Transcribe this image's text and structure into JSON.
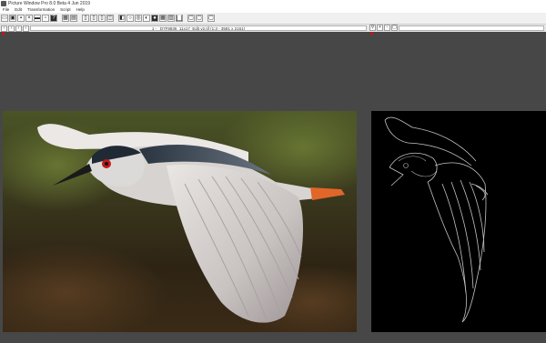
{
  "window": {
    "title": "Picture Window Pro 8.0 Beta 4 Jun 2019"
  },
  "menu": [
    {
      "label": "File"
    },
    {
      "label": "Edit"
    },
    {
      "label": "Transformation"
    },
    {
      "label": "Script"
    },
    {
      "label": "Help"
    }
  ],
  "toolbar": {
    "help_glyph": "?"
  },
  "nav": {
    "path": "1 - _D7F8836_11x17_Edit v2.tif (1:3 - 3581 x 2161)"
  },
  "zoom": {
    "zoom_in_glyph": "+",
    "zoom_out_glyph": "-"
  },
  "colors": {
    "workspace": "#474747",
    "edge_bg": "#000000"
  }
}
